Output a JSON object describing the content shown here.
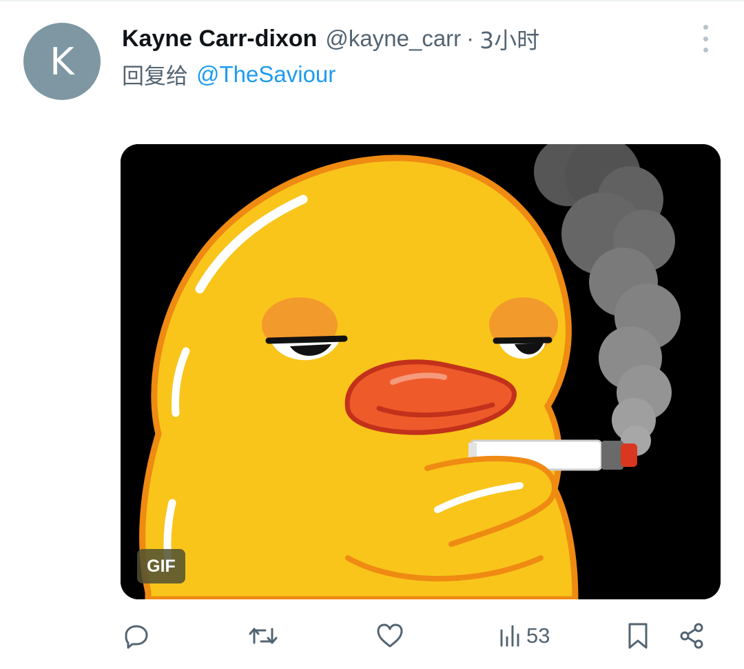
{
  "tweet": {
    "avatar_letter": "K",
    "author_name": "Kayne Carr-dixon",
    "author_handle": "@kayne_carr",
    "separator": "·",
    "time": "3小时",
    "reply_prefix": "回复给",
    "reply_to": "@TheSaviour"
  },
  "media": {
    "type": "animated-gif",
    "badge": "GIF",
    "subject": "cartoon yellow duck smoking a cigarette"
  },
  "actions": {
    "reply_icon": "reply-icon",
    "retweet_icon": "retweet-icon",
    "like_icon": "like-icon",
    "views_icon": "views-icon",
    "views_count": "53",
    "bookmark_icon": "bookmark-icon",
    "share_icon": "share-icon"
  },
  "colors": {
    "link": "#1d9bf0",
    "secondary_text": "#536471",
    "avatar_bg": "#7e97a3",
    "icon": "#536471"
  }
}
